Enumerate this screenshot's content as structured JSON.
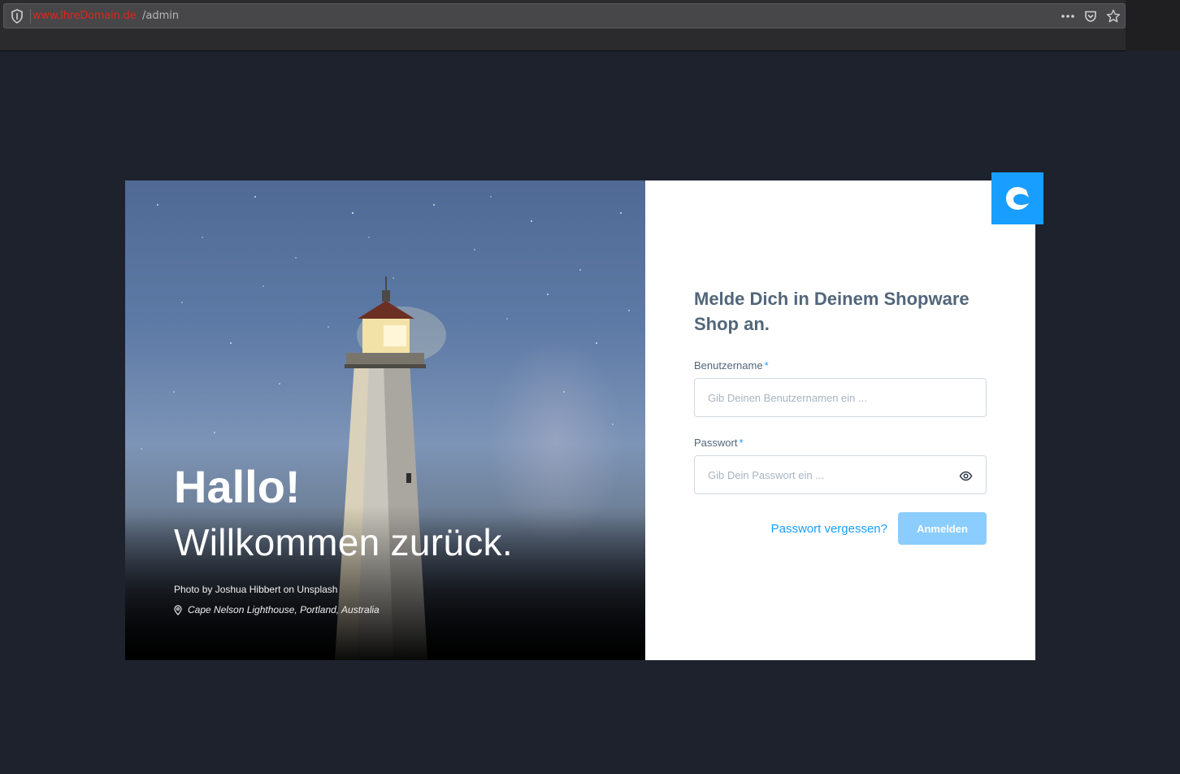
{
  "browser": {
    "url_domain": "www.IhreDomain.de",
    "url_path": "/admin",
    "icons": [
      "shield-icon",
      "more-icon",
      "pocket-icon",
      "star-icon"
    ]
  },
  "hero": {
    "greeting": "Hallo!",
    "welcome": "Willkommen zurück.",
    "photo_credit": "Photo by Joshua Hibbert on Unsplash",
    "location": "Cape Nelson Lighthouse, Portland, Australia"
  },
  "login": {
    "headline": "Melde Dich in Deinem Shopware Shop an.",
    "username_label": "Benutzername",
    "username_placeholder": "Gib Deinen Benutzernamen ein ...",
    "password_label": "Passwort",
    "password_placeholder": "Gib Dein Passwort ein ...",
    "required_mark": "*",
    "forgot_link": "Passwort vergessen?",
    "submit_label": "Anmelden"
  },
  "colors": {
    "background": "#1d222d",
    "accent": "#189eff",
    "button_disabled": "#8bcdff",
    "text": "#52667a"
  }
}
